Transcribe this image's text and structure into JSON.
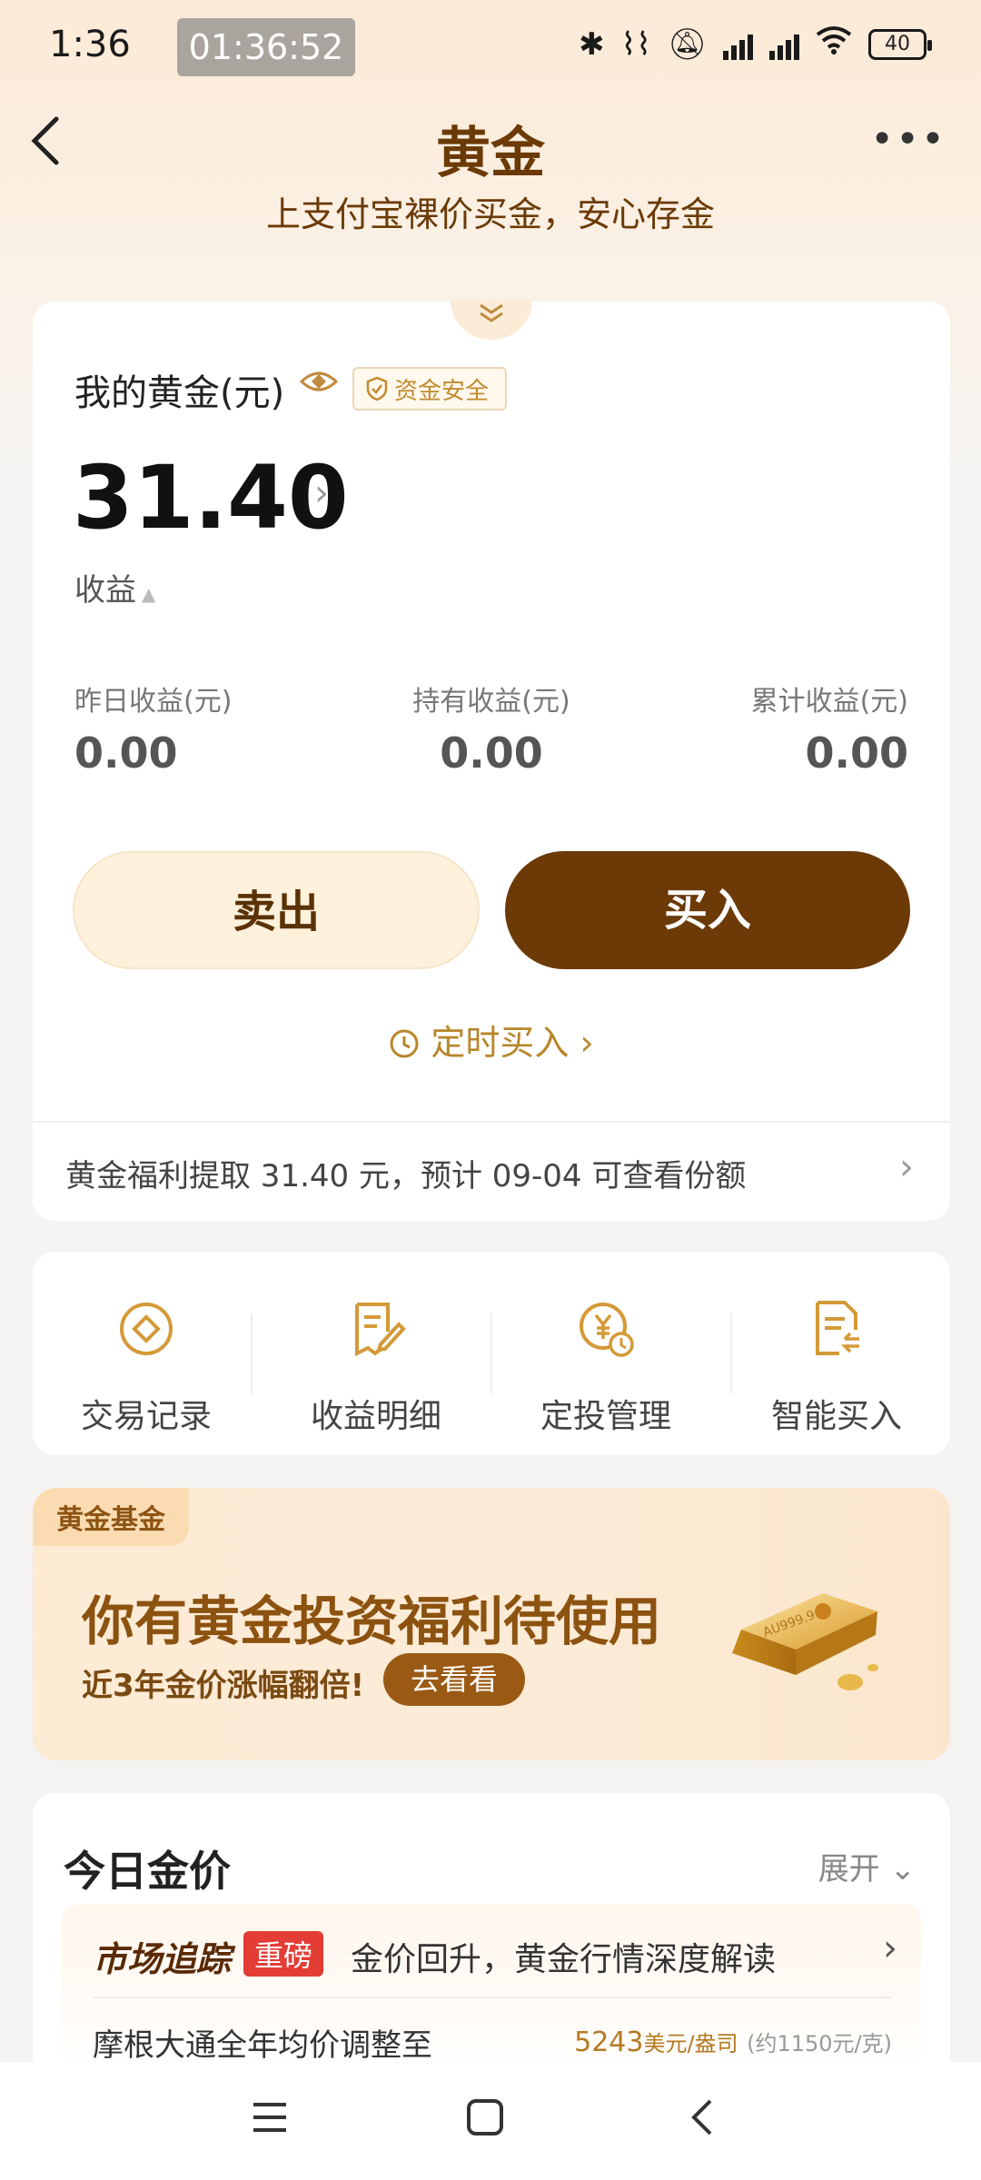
{
  "status_bar": {
    "time": "1:36",
    "recording_timer": "01:36:52",
    "battery": "40"
  },
  "header": {
    "title": "黄金",
    "subtitle": "上支付宝裸价买金，安心存金"
  },
  "holding": {
    "label": "我的黄金(元)",
    "safety_badge": "资金安全",
    "amount": "31.40",
    "earnings_label": "收益",
    "stats": [
      {
        "label": "昨日收益(元)",
        "value": "0.00"
      },
      {
        "label": "持有收益(元)",
        "value": "0.00"
      },
      {
        "label": "累计收益(元)",
        "value": "0.00"
      }
    ],
    "sell_label": "卖出",
    "buy_label": "买入",
    "timed_buy_label": "定时买入",
    "benefit_notice": "黄金福利提取 31.40 元，预计 09-04 可查看份额"
  },
  "quick_actions": [
    {
      "label": "交易记录",
      "icon": "record-icon"
    },
    {
      "label": "收益明细",
      "icon": "earnings-detail-icon"
    },
    {
      "label": "定投管理",
      "icon": "investment-plan-icon"
    },
    {
      "label": "智能买入",
      "icon": "smart-buy-icon"
    }
  ],
  "promo": {
    "tag": "黄金基金",
    "title": "你有黄金投资福利待使用",
    "subtitle": "近3年金价涨幅翻倍!",
    "button": "去看看",
    "bar_engraving": "AU999.9"
  },
  "gold_price": {
    "title": "今日金价",
    "expand_label": "展开",
    "market_logo": "市场追踪",
    "market_badge": "重磅",
    "market_headline": "金价回升，黄金行情深度解读",
    "news_text": "摩根大通全年均价调整至",
    "news_price": "5243",
    "news_unit": "美元/盎司",
    "news_estimate": "(约1150元/克)"
  },
  "colors": {
    "brand_brown": "#6c3a07",
    "accent_gold": "#c08a3e",
    "badge_red": "#e33d36"
  }
}
